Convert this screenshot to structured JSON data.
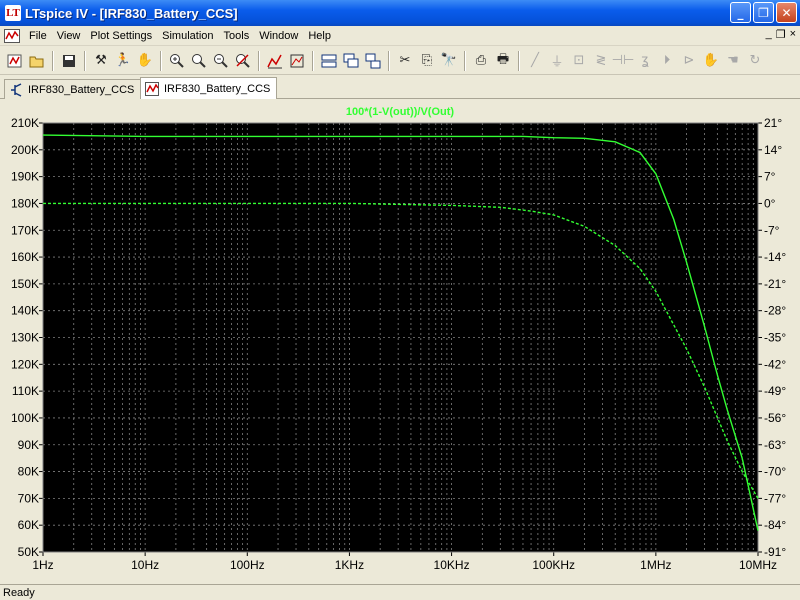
{
  "window": {
    "title": "LTspice IV - [IRF830_Battery_CCS]",
    "app_icon_glyph": "LT",
    "buttons": {
      "minimize": "_",
      "maximize": "❐",
      "close": "✕"
    }
  },
  "menu": {
    "items": [
      "File",
      "View",
      "Plot Settings",
      "Simulation",
      "Tools",
      "Window",
      "Help"
    ],
    "mdi_buttons": [
      "_",
      "❐",
      "×"
    ]
  },
  "toolbar": {
    "icons": [
      "open-schematic-icon",
      "open-file-icon",
      "save-icon",
      "hammer-icon",
      "run-icon",
      "pan-hand-icon",
      "zoom-in-icon",
      "zoom-area-icon",
      "zoom-out-icon",
      "cancel-zoom-icon",
      "autorange-icon",
      "fit-icon",
      "tile-horizontal-icon",
      "cascade-icon",
      "tile-windows-icon",
      "cut-icon",
      "copy-icon",
      "find-icon",
      "print-setup-icon",
      "print-icon",
      "wire-icon",
      "ground-icon",
      "label-icon",
      "resistor-icon",
      "capacitor-icon",
      "inductor-icon",
      "diode-icon",
      "component-icon",
      "move-icon",
      "drag-icon",
      "rotate-icon"
    ]
  },
  "tabs": [
    {
      "label": "IRF830_Battery_CCS",
      "icon": "schematic-icon",
      "active": false
    },
    {
      "label": "IRF830_Battery_CCS",
      "icon": "waveform-icon",
      "active": true
    }
  ],
  "chart_data": {
    "type": "line",
    "title": "100*(1-V(out))/V(Out)",
    "x_scale": "log",
    "xlim": [
      1,
      10000000
    ],
    "x_ticks": [
      "1Hz",
      "10Hz",
      "100Hz",
      "1KHz",
      "10KHz",
      "100KHz",
      "1MHz",
      "10MHz"
    ],
    "ylim": [
      50000,
      210000
    ],
    "y_ticks": [
      "50K",
      "60K",
      "70K",
      "80K",
      "90K",
      "100K",
      "110K",
      "120K",
      "130K",
      "140K",
      "150K",
      "160K",
      "170K",
      "180K",
      "190K",
      "200K",
      "210K"
    ],
    "y2lim": [
      -91,
      21
    ],
    "y2_ticks": [
      "-91°",
      "-84°",
      "-77°",
      "-70°",
      "-63°",
      "-56°",
      "-49°",
      "-42°",
      "-35°",
      "-28°",
      "-21°",
      "-14°",
      "-7°",
      "0°",
      "7°",
      "14°",
      "21°"
    ],
    "grid": true,
    "colors": {
      "background": "#000000",
      "grid": "#808080",
      "trace": "#32FF32",
      "title": "#32FF32",
      "axis_text": "#000000"
    },
    "series": [
      {
        "axis": "left",
        "style": "solid",
        "x": [
          1,
          10,
          100,
          1000,
          10000,
          50000,
          100000,
          200000,
          400000,
          700000,
          1000000,
          1500000,
          2000000,
          3000000,
          4000000,
          5000000,
          7000000,
          10000000
        ],
        "y": [
          205500,
          205000,
          205000,
          205000,
          205000,
          205000,
          204500,
          204300,
          203000,
          199000,
          191000,
          174000,
          158000,
          134000,
          116000,
          103000,
          85000,
          58000
        ]
      },
      {
        "axis": "right",
        "style": "dashed",
        "x": [
          1,
          100,
          1000,
          10000,
          30000,
          60000,
          100000,
          200000,
          400000,
          700000,
          1000000,
          2000000,
          3000000,
          5000000,
          7000000,
          10000000
        ],
        "y": [
          0,
          0,
          0,
          -0.5,
          -1,
          -2,
          -3,
          -6,
          -11,
          -17,
          -23,
          -38,
          -48,
          -62,
          -70,
          -77
        ]
      }
    ]
  },
  "status": {
    "text": "Ready"
  }
}
